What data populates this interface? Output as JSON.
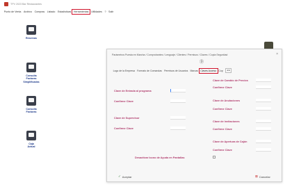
{
  "app": {
    "title": "TPV 2023 Bar Restaurantes"
  },
  "menu": [
    {
      "label": "Punto de Venta",
      "active": false
    },
    {
      "label": "Archivo",
      "active": false
    },
    {
      "label": "Compras",
      "active": false
    },
    {
      "label": "Listado",
      "active": false
    },
    {
      "label": "Estadísticas",
      "active": false
    },
    {
      "label": "Herramientas",
      "active": true
    },
    {
      "label": "Utilidades",
      "active": false
    },
    {
      "label": "?",
      "active": false
    },
    {
      "label": "Salir",
      "active": false
    }
  ],
  "launchers": [
    {
      "label": "Reservas",
      "icon": "calendar-icon"
    },
    {
      "label": "Consulta\nFacturas\nSimplificadas",
      "icon": "receipt-icon"
    },
    {
      "label": "Consulta\nFacturas",
      "icon": "invoice-icon"
    },
    {
      "label": "Caja\nActual",
      "icon": "cash-register-icon"
    }
  ],
  "dialog": {
    "title": "Parámetros Puesta en Marcha / Comprobantes / Lenguaje / Clientes / Permisos / Claves / Copia Seguridad",
    "close_glyph": "×",
    "glyph": "Ⓓ",
    "tabs": [
      {
        "label": "Logo de la Empresa",
        "active": false
      },
      {
        "label": "Formato de Comandas",
        "active": false
      },
      {
        "label": "Permisos de Usuarios",
        "active": false
      },
      {
        "label": "Marcas",
        "active": false
      },
      {
        "label": "Claves Acceso",
        "active": true
      },
      {
        "label": "Cop",
        "active": false
      }
    ],
    "tab_scroll": "◂ ▸",
    "left_fields": [
      {
        "label": "Clave de Entrada al programa",
        "focused": true
      },
      {
        "label": "Confirme Clave",
        "focused": false
      },
      {
        "label": "Clave de Supervisor",
        "focused": false
      },
      {
        "label": "Confirme Clave",
        "focused": false
      }
    ],
    "right_fields": [
      {
        "label": "Clave de Cambio de Precios"
      },
      {
        "label": "Confirme Clave"
      },
      {
        "label": "Clave de Anulaciones"
      },
      {
        "label": "Confirme Clave"
      },
      {
        "label": "Clave de Invitaciones"
      },
      {
        "label": "Confirme Clave"
      },
      {
        "label": "Clave de Apertura de Cajón"
      },
      {
        "label": "Confirme Clave"
      }
    ],
    "checkbox_label": "Desactivar Icono de Ayuda en Pantallas",
    "accept_label": "Aceptar",
    "accept_glyph": "✓",
    "cancel_label": "Cancelar",
    "cancel_glyph": "⊠"
  },
  "colors": {
    "highlight": "#d0142c",
    "label": "#b03a6b",
    "launcher_label": "#1e3a8a"
  }
}
